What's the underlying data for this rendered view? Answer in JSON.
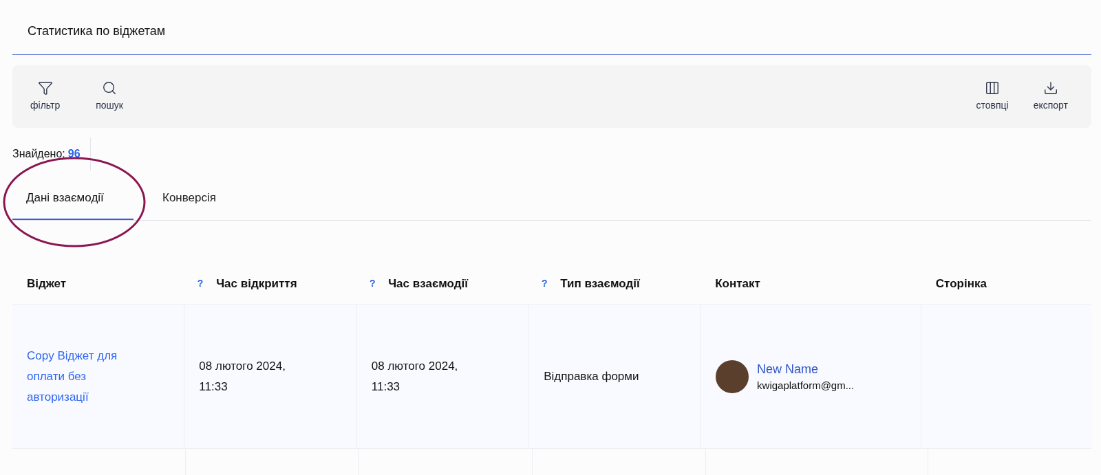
{
  "page": {
    "title": "Статистика по віджетам"
  },
  "toolbar": {
    "left": [
      {
        "kind": "filter",
        "label": "фільтр"
      },
      {
        "kind": "search",
        "label": "пошук"
      }
    ],
    "right": [
      {
        "kind": "columns",
        "label": "стовпці"
      },
      {
        "kind": "export",
        "label": "експорт"
      }
    ]
  },
  "found": {
    "label": "Знайдено:",
    "count": "96"
  },
  "tabs": [
    {
      "label": "Дані взаємодії",
      "selected": true
    },
    {
      "label": "Конверсія",
      "selected": false
    }
  ],
  "annotation": {
    "kind": "ellipse",
    "color": "#8b1650"
  },
  "table": {
    "columns": [
      {
        "label": "Віджет"
      },
      {
        "label": "Час відкриття",
        "help": "?"
      },
      {
        "label": "Час взаємодії",
        "help": "?"
      },
      {
        "label": "Тип взаємодії",
        "help": "?"
      },
      {
        "label": "Контакт"
      },
      {
        "label": "Сторінка"
      }
    ],
    "rows": [
      {
        "widget": "Copy Віджет для оплати без авторизації",
        "opened": "08 лютого 2024, 11:33",
        "interacted": "08 лютого 2024, 11:33",
        "type": "Відправка форми",
        "contact": {
          "name": "New Name",
          "email": "kwigaplatform@gm..."
        }
      }
    ]
  }
}
